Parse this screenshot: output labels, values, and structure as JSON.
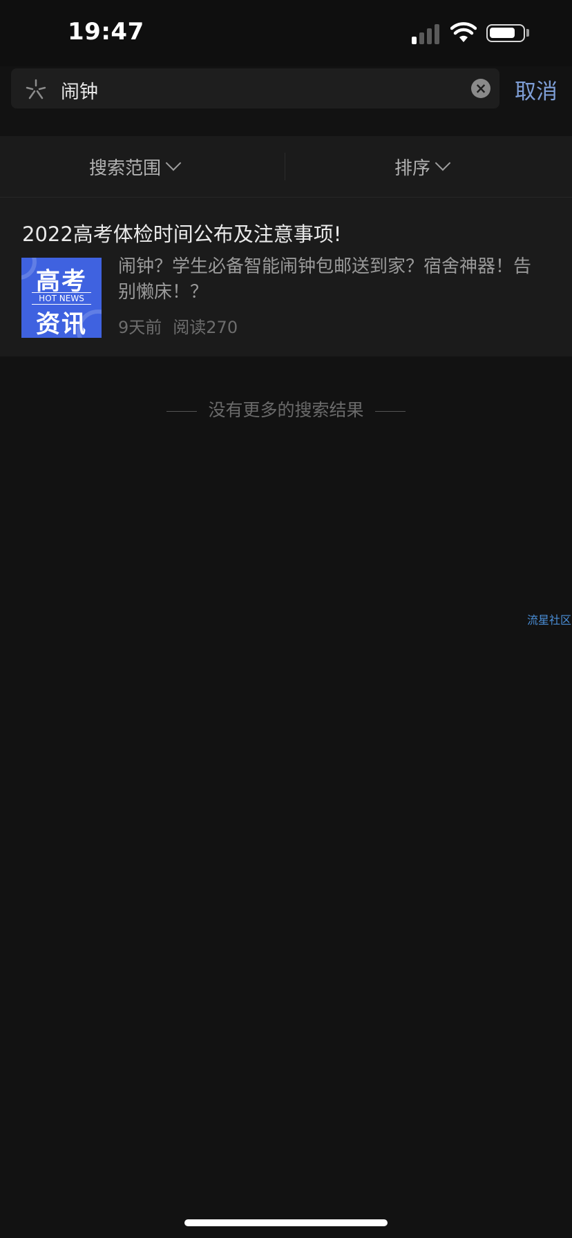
{
  "status_bar": {
    "time": "19:47"
  },
  "search": {
    "query": "闹钟",
    "cancel_label": "取消"
  },
  "filters": [
    {
      "label": "搜索范围"
    },
    {
      "label": "排序"
    }
  ],
  "results": [
    {
      "title": "2022高考体检时间公布及注意事项!",
      "thumbnail": {
        "line1": "高考",
        "line2": "HOT NEWS",
        "line3": "资讯"
      },
      "snippet": "闹钟？学生必备智能闹钟包邮送到家？宿舍神器！告别懒床！？",
      "time_ago": "9天前",
      "reads": "阅读270"
    }
  ],
  "end_message": "没有更多的搜索结果",
  "watermark": "流星社区"
}
